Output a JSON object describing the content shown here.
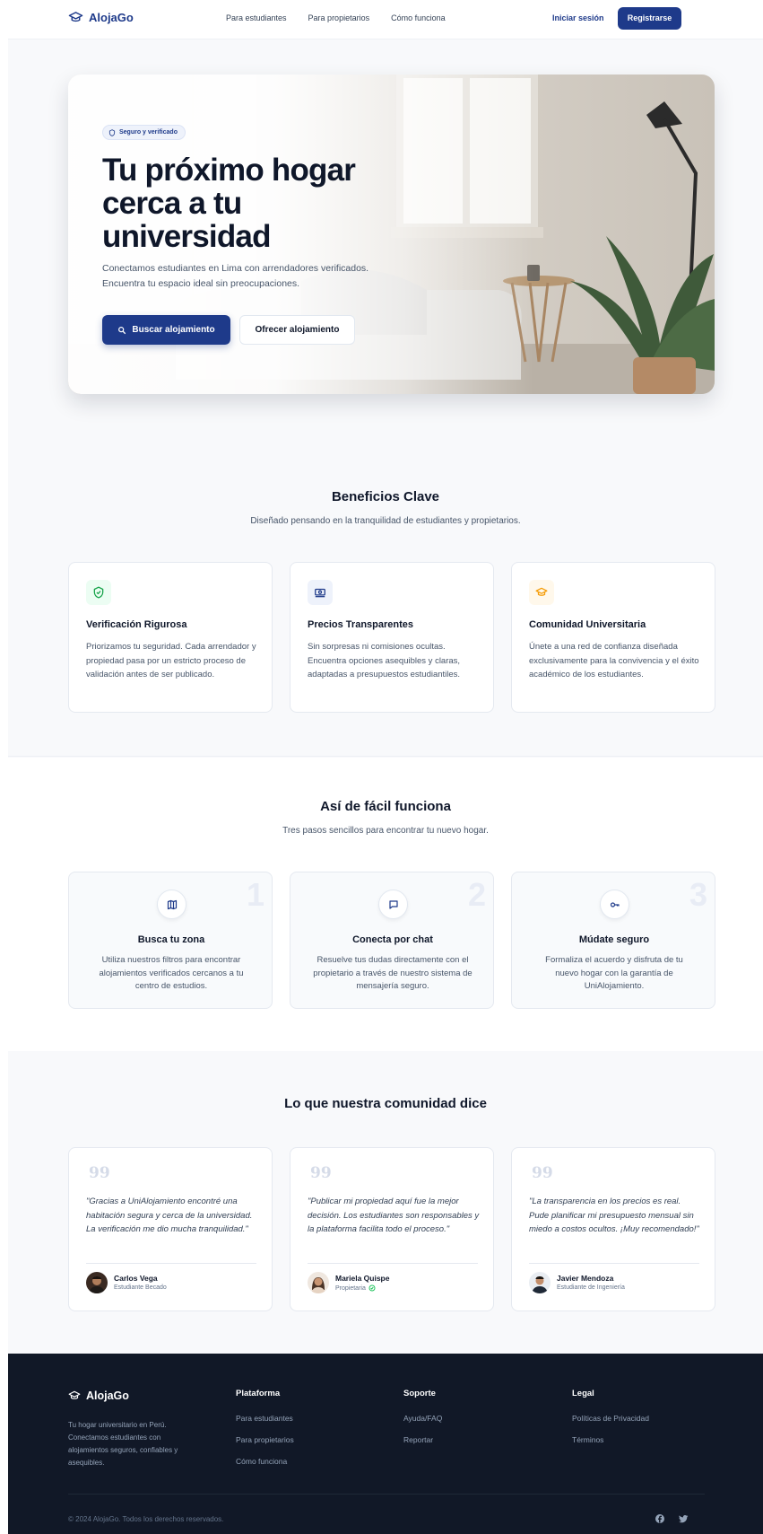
{
  "brand": {
    "name": "AlojaGo",
    "logo_icon": "graduation-cap-icon",
    "primary_color": "#1e3a8a"
  },
  "nav": {
    "links": [
      "Para estudiantes",
      "Para propietarios",
      "Cómo funciona"
    ],
    "login_label": "Iniciar sesión",
    "signup_label": "Registrarse"
  },
  "hero": {
    "badge": "Seguro y verificado",
    "title": "Tu próximo hogar cerca a tu universidad",
    "subtitle": "Conectamos estudiantes en Lima con arrendadores verificados. Encuentra tu espacio ideal sin preocupaciones.",
    "primary_button": "Buscar alojamiento",
    "secondary_button": "Ofrecer alojamiento"
  },
  "benefits": {
    "title": "Beneficios Clave",
    "subtitle": "Diseñado pensando en la tranquilidad de estudiantes y propietarios.",
    "items": [
      {
        "icon": "shield-check-icon",
        "color": "#16a34a",
        "title": "Verificación Rigurosa",
        "text": "Priorizamos tu seguridad. Cada arrendador y propiedad pasa por un estricto proceso de validación antes de ser publicado."
      },
      {
        "icon": "money-icon",
        "color": "#1e3a8a",
        "title": "Precios Transparentes",
        "text": "Sin sorpresas ni comisiones ocultas. Encuentra opciones asequibles y claras, adaptadas a presupuestos estudiantiles."
      },
      {
        "icon": "graduation-cap-icon",
        "color": "#f59e0b",
        "title": "Comunidad Universitaria",
        "text": "Únete a una red de confianza diseñada exclusivamente para la convivencia y el éxito académico de los estudiantes."
      }
    ]
  },
  "steps": {
    "title": "Así de fácil funciona",
    "subtitle": "Tres pasos sencillos para encontrar tu nuevo hogar.",
    "items": [
      {
        "number": "1",
        "icon": "map-icon",
        "title": "Busca tu zona",
        "text": "Utiliza nuestros filtros para encontrar alojamientos verificados cercanos a tu centro de estudios."
      },
      {
        "number": "2",
        "icon": "chat-icon",
        "title": "Conecta por chat",
        "text": "Resuelve tus dudas directamente con el propietario a través de nuestro sistema de mensajería seguro."
      },
      {
        "number": "3",
        "icon": "key-icon",
        "title": "Múdate seguro",
        "text": "Formaliza el acuerdo y disfruta de tu nuevo hogar con la garantía de UniAlojamiento."
      }
    ]
  },
  "testimonials": {
    "title": "Lo que nuestra comunidad dice",
    "quote_mark": "99",
    "items": [
      {
        "quote": "\"Gracias a UniAlojamiento encontré una habitación segura y cerca de la universidad. La verificación me dio mucha tranquilidad.\"",
        "name": "Carlos Vega",
        "role": "Estudiante Becado",
        "verified": false
      },
      {
        "quote": "\"Publicar mi propiedad aquí fue la mejor decisión. Los estudiantes son responsables y la plataforma facilita todo el proceso.\"",
        "name": "Mariela Quispe",
        "role": "Propietaria",
        "verified": true
      },
      {
        "quote": "\"La transparencia en los precios es real. Pude planificar mi presupuesto mensual sin miedo a costos ocultos. ¡Muy recomendado!\"",
        "name": "Javier Mendoza",
        "role": "Estudiante de Ingeniería",
        "verified": false
      }
    ]
  },
  "footer": {
    "brand": "AlojaGo",
    "description": "Tu hogar universitario en Perú. Conectamos estudiantes con alojamientos seguros, confiables y asequibles.",
    "columns": [
      {
        "title": "Plataforma",
        "links": [
          "Para estudiantes",
          "Para propietarios",
          "Cómo funciona"
        ]
      },
      {
        "title": "Soporte",
        "links": [
          "Ayuda/FAQ",
          "Reportar"
        ]
      },
      {
        "title": "Legal",
        "links": [
          "Políticas de Privacidad",
          "Términos"
        ]
      }
    ],
    "copyright": "© 2024 AlojaGo. Todos los derechos reservados.",
    "social": [
      "facebook-icon",
      "twitter-icon"
    ]
  }
}
